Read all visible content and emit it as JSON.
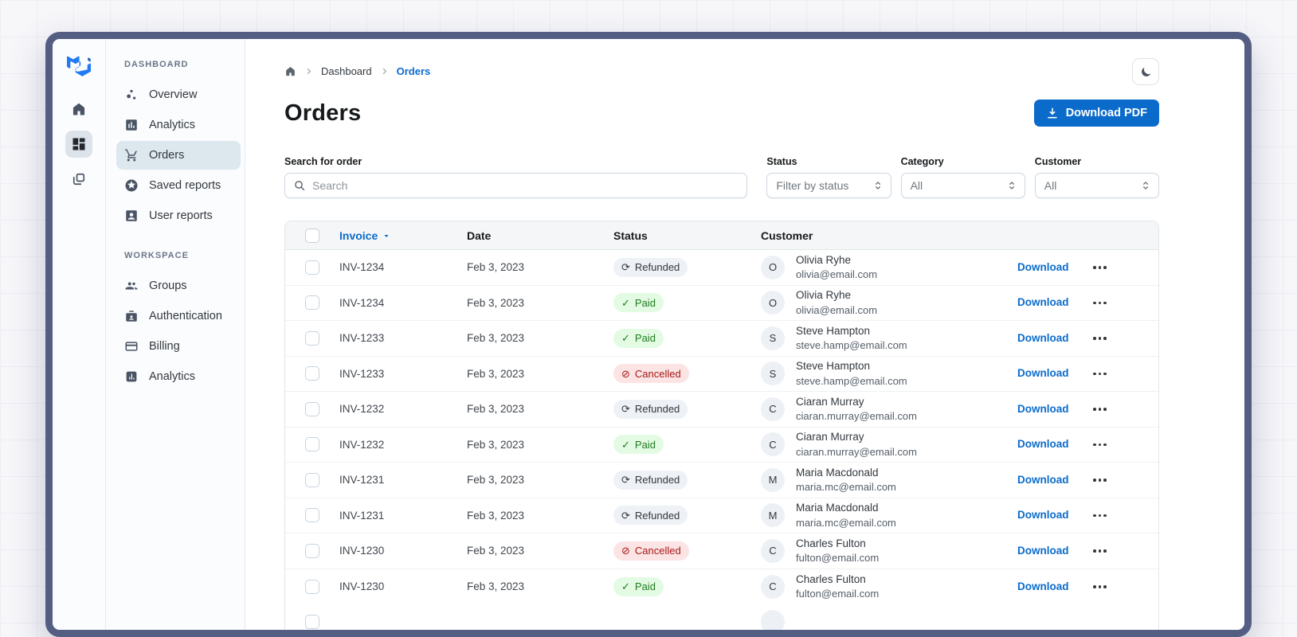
{
  "theme": {
    "accent": "#0b6bcb",
    "frame": "#545e83",
    "paid_bg": "#e3fbe3",
    "paid_text": "#1f7a1f",
    "refunded_bg": "#eef1f6",
    "refunded_text": "#32383e",
    "cancelled_bg": "#fce4e4",
    "cancelled_text": "#a51818"
  },
  "sidebar": {
    "rail": {
      "icons": [
        "mui-logo",
        "home",
        "dashboard-selected",
        "layers"
      ]
    },
    "sections": [
      {
        "label": "DASHBOARD",
        "items": [
          {
            "icon": "scatter-icon",
            "label": "Overview"
          },
          {
            "icon": "bar-chart-icon",
            "label": "Analytics"
          },
          {
            "icon": "cart-icon",
            "label": "Orders",
            "selected": true
          },
          {
            "icon": "star-icon",
            "label": "Saved reports"
          },
          {
            "icon": "person-icon",
            "label": "User reports"
          }
        ]
      },
      {
        "label": "WORKSPACE",
        "items": [
          {
            "icon": "groups-icon",
            "label": "Groups"
          },
          {
            "icon": "badge-icon",
            "label": "Authentication"
          },
          {
            "icon": "credit-card-icon",
            "label": "Billing"
          },
          {
            "icon": "analytics-icon",
            "label": "Analytics"
          }
        ]
      }
    ]
  },
  "breadcrumb": {
    "items": [
      "Dashboard",
      "Orders"
    ]
  },
  "page": {
    "title": "Orders",
    "download_button": "Download PDF"
  },
  "filters": {
    "search": {
      "label": "Search for order",
      "placeholder": "Search"
    },
    "status": {
      "label": "Status",
      "value": "Filter by status"
    },
    "category": {
      "label": "Category",
      "value": "All"
    },
    "customer": {
      "label": "Customer",
      "value": "All"
    }
  },
  "table": {
    "columns": {
      "invoice": "Invoice",
      "date": "Date",
      "status": "Status",
      "customer": "Customer"
    },
    "row_action": "Download",
    "status_icons": {
      "Refunded": "⟳",
      "Paid": "✓",
      "Cancelled": "⊘"
    },
    "rows": [
      {
        "invoice": "INV-1234",
        "date": "Feb 3, 2023",
        "status": "Refunded",
        "initial": "O",
        "name": "Olivia Ryhe",
        "email": "olivia@email.com"
      },
      {
        "invoice": "INV-1234",
        "date": "Feb 3, 2023",
        "status": "Paid",
        "initial": "O",
        "name": "Olivia Ryhe",
        "email": "olivia@email.com"
      },
      {
        "invoice": "INV-1233",
        "date": "Feb 3, 2023",
        "status": "Paid",
        "initial": "S",
        "name": "Steve Hampton",
        "email": "steve.hamp@email.com"
      },
      {
        "invoice": "INV-1233",
        "date": "Feb 3, 2023",
        "status": "Cancelled",
        "initial": "S",
        "name": "Steve Hampton",
        "email": "steve.hamp@email.com"
      },
      {
        "invoice": "INV-1232",
        "date": "Feb 3, 2023",
        "status": "Refunded",
        "initial": "C",
        "name": "Ciaran Murray",
        "email": "ciaran.murray@email.com"
      },
      {
        "invoice": "INV-1232",
        "date": "Feb 3, 2023",
        "status": "Paid",
        "initial": "C",
        "name": "Ciaran Murray",
        "email": "ciaran.murray@email.com"
      },
      {
        "invoice": "INV-1231",
        "date": "Feb 3, 2023",
        "status": "Refunded",
        "initial": "M",
        "name": "Maria Macdonald",
        "email": "maria.mc@email.com"
      },
      {
        "invoice": "INV-1231",
        "date": "Feb 3, 2023",
        "status": "Refunded",
        "initial": "M",
        "name": "Maria Macdonald",
        "email": "maria.mc@email.com"
      },
      {
        "invoice": "INV-1230",
        "date": "Feb 3, 2023",
        "status": "Cancelled",
        "initial": "C",
        "name": "Charles Fulton",
        "email": "fulton@email.com"
      },
      {
        "invoice": "INV-1230",
        "date": "Feb 3, 2023",
        "status": "Paid",
        "initial": "C",
        "name": "Charles Fulton",
        "email": "fulton@email.com"
      }
    ]
  }
}
